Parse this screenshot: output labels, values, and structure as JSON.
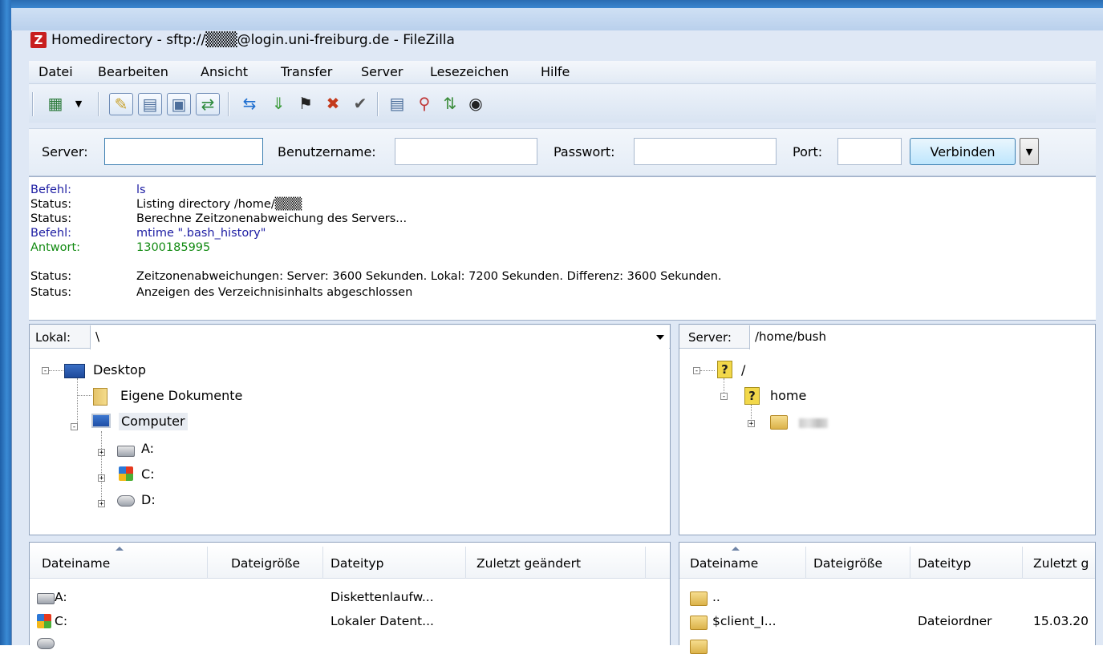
{
  "window": {
    "title": "Homedirectory - sftp://▒▒▒@login.uni-freiburg.de - FileZilla",
    "app_icon": "Z"
  },
  "menu": [
    "Datei",
    "Bearbeiten",
    "Ansicht",
    "Transfer",
    "Server",
    "Lesezeichen",
    "Hilfe"
  ],
  "toolbar": {
    "icons": [
      "site-manager-icon",
      "site-manager-dropdown-icon",
      "toggle-log-icon",
      "toggle-local-tree-icon",
      "toggle-remote-tree-icon",
      "toggle-queue-icon",
      "refresh-icon",
      "process-queue-icon",
      "cancel-icon",
      "disconnect-icon",
      "reconnect-icon",
      "directory-listing-filter-icon",
      "toggle-sync-browsing-icon",
      "directory-comparison-icon",
      "search-remote-files-icon"
    ]
  },
  "quickconnect": {
    "server_label": "Server:",
    "user_label": "Benutzername:",
    "password_label": "Passwort:",
    "port_label": "Port:",
    "server_value": "",
    "user_value": "",
    "password_value": "",
    "port_value": "",
    "connect_label": "Verbinden"
  },
  "log": [
    {
      "type": "Befehl:",
      "text": "ls",
      "kind": "cmd"
    },
    {
      "type": "Status:",
      "text": "Listing directory /home/▒▒▒",
      "kind": "status"
    },
    {
      "type": "Status:",
      "text": "Berechne Zeitzonenabweichung des Servers...",
      "kind": "status"
    },
    {
      "type": "Befehl:",
      "text": "mtime \".bash_history\"",
      "kind": "cmd"
    },
    {
      "type": "Antwort:",
      "text": "1300185995",
      "kind": "resp"
    },
    {
      "type": "Status:",
      "text": "Zeitzonenabweichungen: Server: 3600 Sekunden. Lokal: 7200 Sekunden. Differenz: 3600 Sekunden.",
      "kind": "status"
    },
    {
      "type": "Status:",
      "text": "Anzeigen des Verzeichnisinhalts abgeschlossen",
      "kind": "status"
    }
  ],
  "colors": {
    "command": "#1d1da3",
    "response": "#138b13",
    "status": "#000000"
  },
  "local": {
    "path_label": "Lokal:",
    "path": "\\",
    "tree": {
      "desktop": "Desktop",
      "documents": "Eigene Dokumente",
      "computer": "Computer",
      "drive_a": "A:",
      "drive_c": "C:",
      "drive_d": "D:"
    },
    "columns": [
      "Dateiname",
      "Dateigröße",
      "Dateityp",
      "Zuletzt geändert"
    ],
    "rows": [
      {
        "name": "A:",
        "type": "Diskettenlaufw...",
        "icon": "floppy-drive-icon"
      },
      {
        "name": "C:",
        "type": "Lokaler Datent...",
        "icon": "local-disk-icon"
      }
    ]
  },
  "remote": {
    "path_label": "Server:",
    "path": "/home/bush",
    "tree": {
      "root": "/",
      "home": "home"
    },
    "columns": [
      "Dateiname",
      "Dateigröße",
      "Dateityp",
      "Zuletzt g"
    ],
    "rows": [
      {
        "name": "..",
        "type": "",
        "modified": "",
        "icon": "folder-icon"
      },
      {
        "name": "$client_I...",
        "type": "Dateiordner",
        "modified": "15.03.20",
        "icon": "folder-icon"
      }
    ]
  }
}
